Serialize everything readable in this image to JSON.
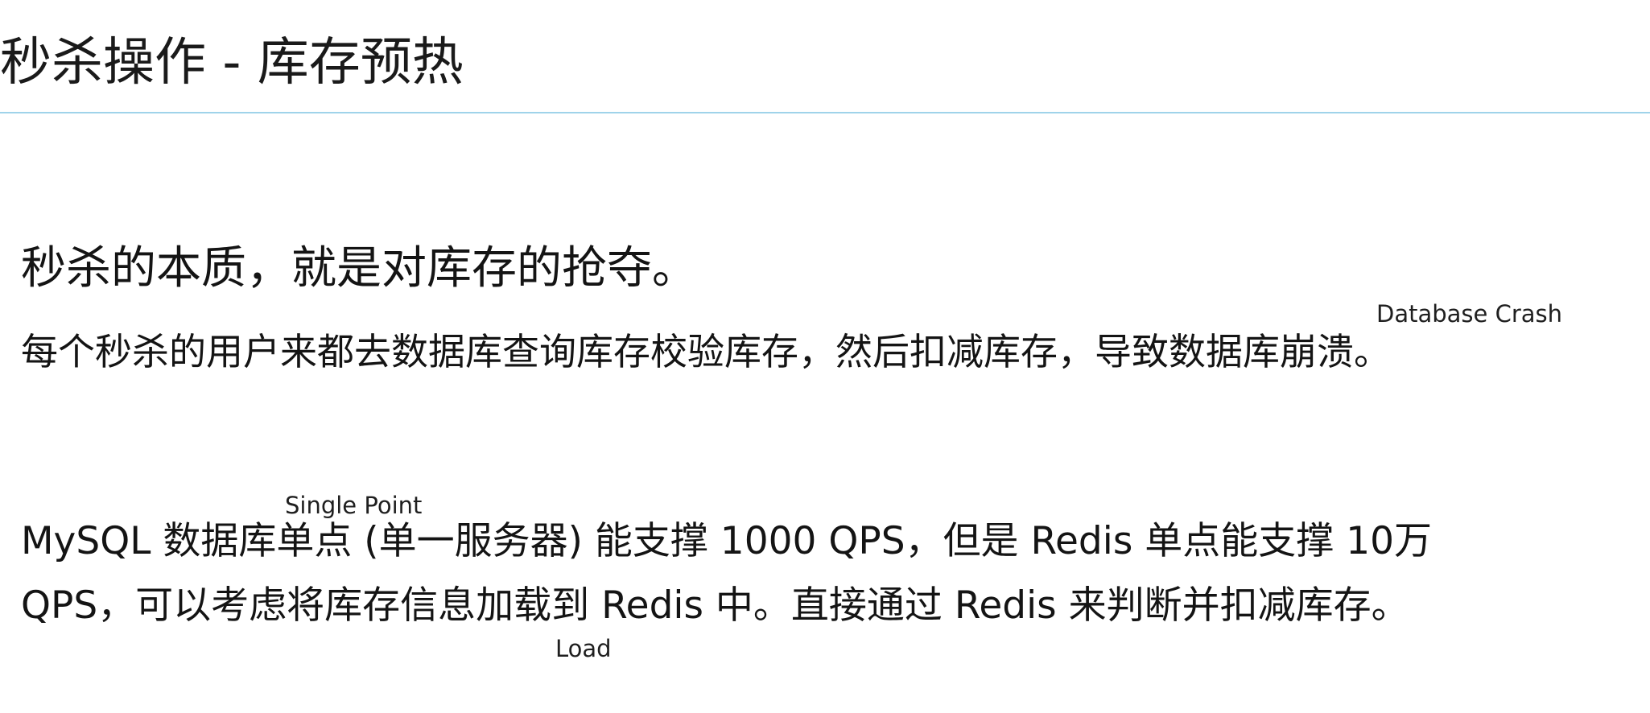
{
  "slide": {
    "title": "秒杀操作 - 库存预热",
    "heading": "秒杀的本质，就是对库存的抢夺。",
    "description": "每个秒杀的用户来都去数据库查询库存校验库存，然后扣减库存，导致数据库崩溃。",
    "body_line_1": "MySQL 数据库单点 (单一服务器) 能支撑 1000 QPS，但是 Redis 单点能支撑 10万",
    "body_line_2": "QPS，可以考虑将库存信息加载到 Redis 中。直接通过 Redis 来判断并扣减库存。"
  },
  "annotations": {
    "database_crash": "Database Crash",
    "single_point": "Single Point",
    "load": "Load"
  },
  "colors": {
    "title_rule": "#9fd3ea",
    "text": "#141414",
    "background": "#ffffff"
  }
}
